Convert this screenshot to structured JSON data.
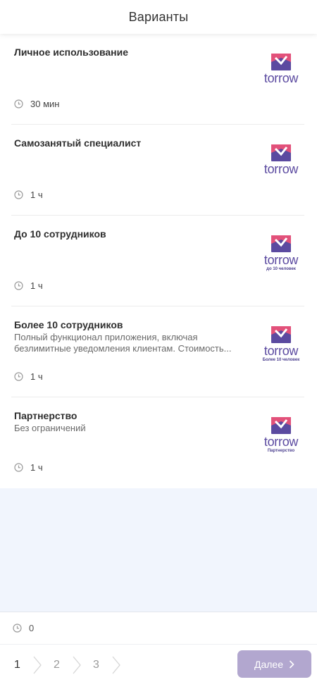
{
  "header": {
    "title": "Варианты"
  },
  "options": [
    {
      "title": "Личное использование",
      "description": "",
      "duration": "30 мин",
      "logo_word": "torrow",
      "logo_sub": ""
    },
    {
      "title": "Самозанятый специалист",
      "description": "",
      "duration": "1 ч",
      "logo_word": "torrow",
      "logo_sub": ""
    },
    {
      "title": "До 10 сотрудников",
      "description": "",
      "duration": "1 ч",
      "logo_word": "torrow",
      "logo_sub": "до 10 человек"
    },
    {
      "title": "Более 10 сотрудников",
      "description": "Полный функционал приложения, включая безлимитные уведомления клиентам. Стоимость...",
      "duration": "1 ч",
      "logo_word": "torrow",
      "logo_sub": "Более 10 человек"
    },
    {
      "title": "Партнерство",
      "description": "Без ограничений",
      "duration": "1 ч",
      "logo_word": "torrow",
      "logo_sub": "Партнерство"
    }
  ],
  "summary": {
    "duration": "0"
  },
  "footer": {
    "steps": [
      "1",
      "2",
      "3"
    ],
    "active_step": "1",
    "next_label": "Далее"
  },
  "colors": {
    "accent": "#b2a7cf",
    "logo_pink": "#e2517a",
    "logo_purple": "#5b4aa0",
    "background": "#f1f5fd"
  },
  "icons": {
    "duration": "clock-icon",
    "step_separator": "chevron-right-icon",
    "next": "chevron-right-icon"
  }
}
